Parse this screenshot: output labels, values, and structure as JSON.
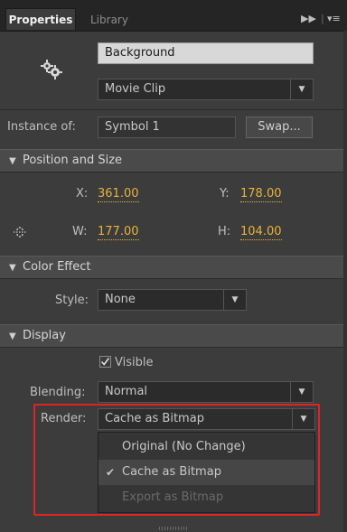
{
  "tabs": {
    "active": "Properties",
    "inactive": "Library"
  },
  "header": {
    "instance_name": "Background",
    "symbol_type": "Movie Clip",
    "instance_of_label": "Instance of:",
    "instance_of_value": "Symbol 1",
    "swap_label": "Swap..."
  },
  "position": {
    "title": "Position and Size",
    "x_label": "X:",
    "x_value": "361.00",
    "y_label": "Y:",
    "y_value": "178.00",
    "w_label": "W:",
    "w_value": "177.00",
    "h_label": "H:",
    "h_value": "104.00"
  },
  "color_effect": {
    "title": "Color Effect",
    "style_label": "Style:",
    "style_value": "None"
  },
  "display": {
    "title": "Display",
    "visible_label": "Visible",
    "visible_checked": true,
    "blending_label": "Blending:",
    "blending_value": "Normal",
    "render_label": "Render:",
    "render_value": "Cache as Bitmap",
    "render_options": [
      "Original (No Change)",
      "Cache as Bitmap",
      "Export as Bitmap"
    ]
  },
  "colors": {
    "value_accent": "#e8b23b",
    "highlight_box": "#e02424"
  }
}
